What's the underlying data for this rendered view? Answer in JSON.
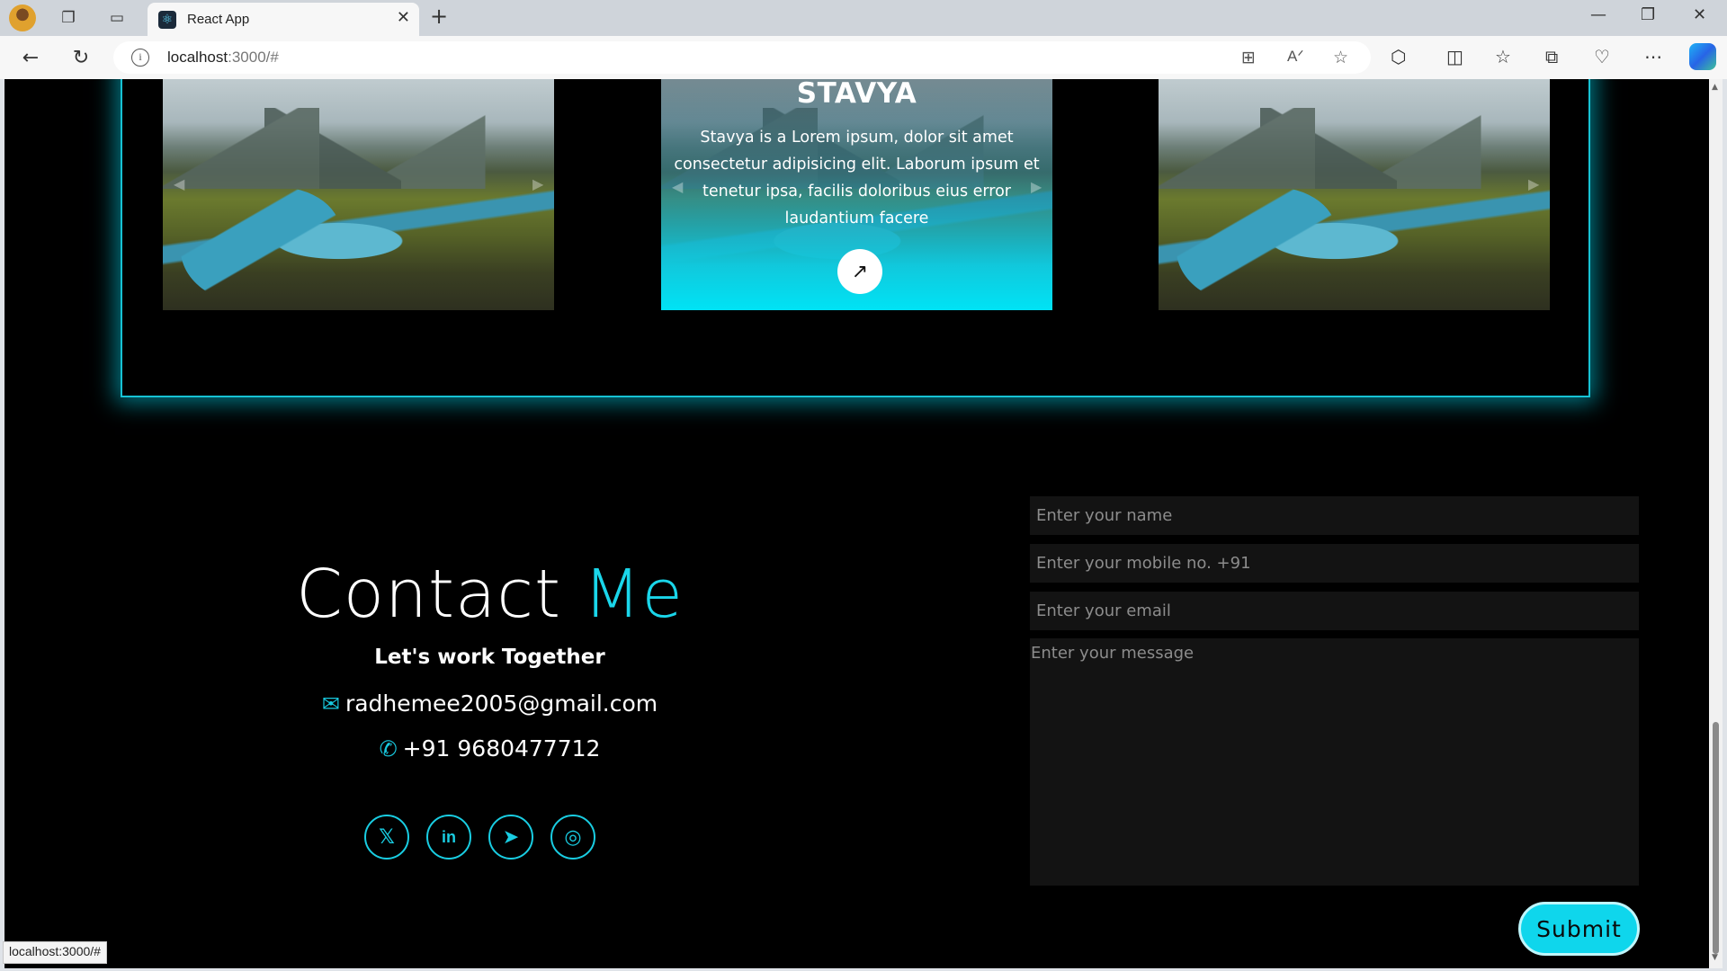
{
  "browser": {
    "tab_title": "React App",
    "url_host": "localhost",
    "url_rest": ":3000/#",
    "status_url": "localhost:3000/#"
  },
  "carousel": {
    "center_card": {
      "title": "STAVYA",
      "description": "Stavya is a Lorem ipsum, dolor sit amet consectetur adipisicing elit. Laborum ipsum et tenetur ipsa, facilis doloribus eius error laudantium facere"
    }
  },
  "contact": {
    "title_main": "Contact ",
    "title_accent": "Me",
    "subtitle": "Let's work Together",
    "email": "radhemee2005@gmail.com",
    "phone": "+91 9680477712",
    "socials": [
      "x",
      "linkedin",
      "telegram",
      "instagram"
    ]
  },
  "form": {
    "name_placeholder": "Enter your name",
    "mobile_placeholder": "Enter your mobile no. +91",
    "email_placeholder": "Enter your email",
    "message_placeholder": "Enter your message",
    "submit_label": "Submit"
  },
  "colors": {
    "accent": "#1ad6ea",
    "page_bg": "#000000",
    "field_bg": "#131313"
  }
}
